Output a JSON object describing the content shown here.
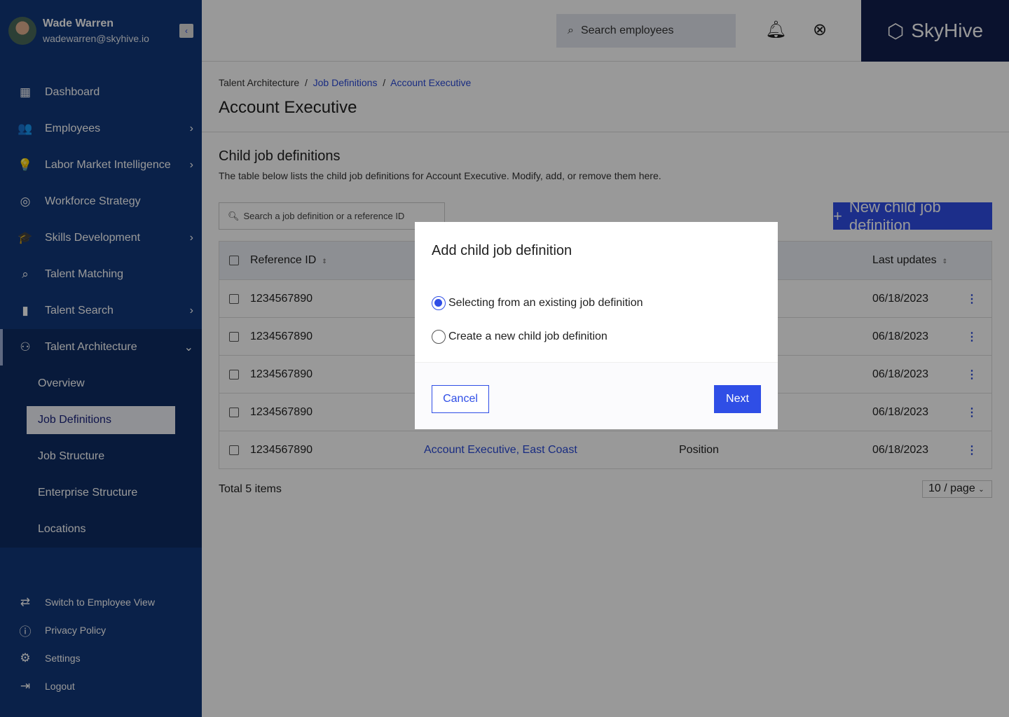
{
  "user": {
    "name": "Wade Warren",
    "email": "wadewarren@skyhive.io"
  },
  "nav": [
    {
      "label": "Dashboard",
      "icon": "dashboard-icon",
      "glyph": "▦"
    },
    {
      "label": "Employees",
      "icon": "employees-icon",
      "glyph": "👥"
    },
    {
      "label": "Labor Market Intelligence",
      "icon": "lightbulb-icon",
      "glyph": "💡"
    },
    {
      "label": "Workforce Strategy",
      "icon": "target-icon",
      "glyph": "◎"
    },
    {
      "label": "Skills Development",
      "icon": "graduation-cap-icon",
      "glyph": "🎓"
    },
    {
      "label": "Talent Matching",
      "icon": "search-person-icon",
      "glyph": "⌕"
    },
    {
      "label": "Talent Search",
      "icon": "bar-chart-icon",
      "glyph": "▮"
    },
    {
      "label": "Talent Architecture",
      "icon": "hierarchy-icon",
      "glyph": "⚇"
    }
  ],
  "subnav": [
    "Overview",
    "Job Definitions",
    "Job Structure",
    "Enterprise Structure",
    "Locations"
  ],
  "bottom": [
    {
      "label": "Switch to Employee View",
      "glyph": "⇄"
    },
    {
      "label": "Privacy Policy",
      "glyph": "ⓘ"
    },
    {
      "label": "Settings",
      "glyph": "⚙"
    },
    {
      "label": "Logout",
      "glyph": "⇥"
    }
  ],
  "header": {
    "search_placeholder": "Search employees",
    "brand": "SkyHive"
  },
  "breadcrumb": [
    "Talent Architecture",
    "Job Definitions",
    "Account Executive"
  ],
  "page_title": "Account Executive",
  "section": {
    "title": "Child job definitions",
    "description": "The table below lists the child job definitions for Account Executive. Modify, add, or remove them here.",
    "search_placeholder": "Search a job definition or a reference ID",
    "new_button": "New child job definition"
  },
  "table": {
    "headers": [
      "Reference ID",
      "",
      "",
      "Last updates"
    ],
    "rows": [
      [
        "1234567890",
        "",
        "",
        "06/18/2023"
      ],
      [
        "1234567890",
        "",
        "",
        "06/18/2023"
      ],
      [
        "1234567890",
        "",
        "",
        "06/18/2023"
      ],
      [
        "1234567890",
        "",
        "",
        "06/18/2023"
      ],
      [
        "1234567890",
        "Account Executive, East Coast",
        "Position",
        "06/18/2023"
      ]
    ]
  },
  "footer": {
    "total": "Total 5 items",
    "page_size": "10 / page"
  },
  "modal": {
    "title": "Add child job definition",
    "option1": "Selecting from an existing job definition",
    "option2": "Create a new child job definition",
    "selected": "option1",
    "cancel": "Cancel",
    "next": "Next"
  },
  "colors": {
    "sidebar": "#0b2148",
    "accent": "#2f4ee6"
  }
}
